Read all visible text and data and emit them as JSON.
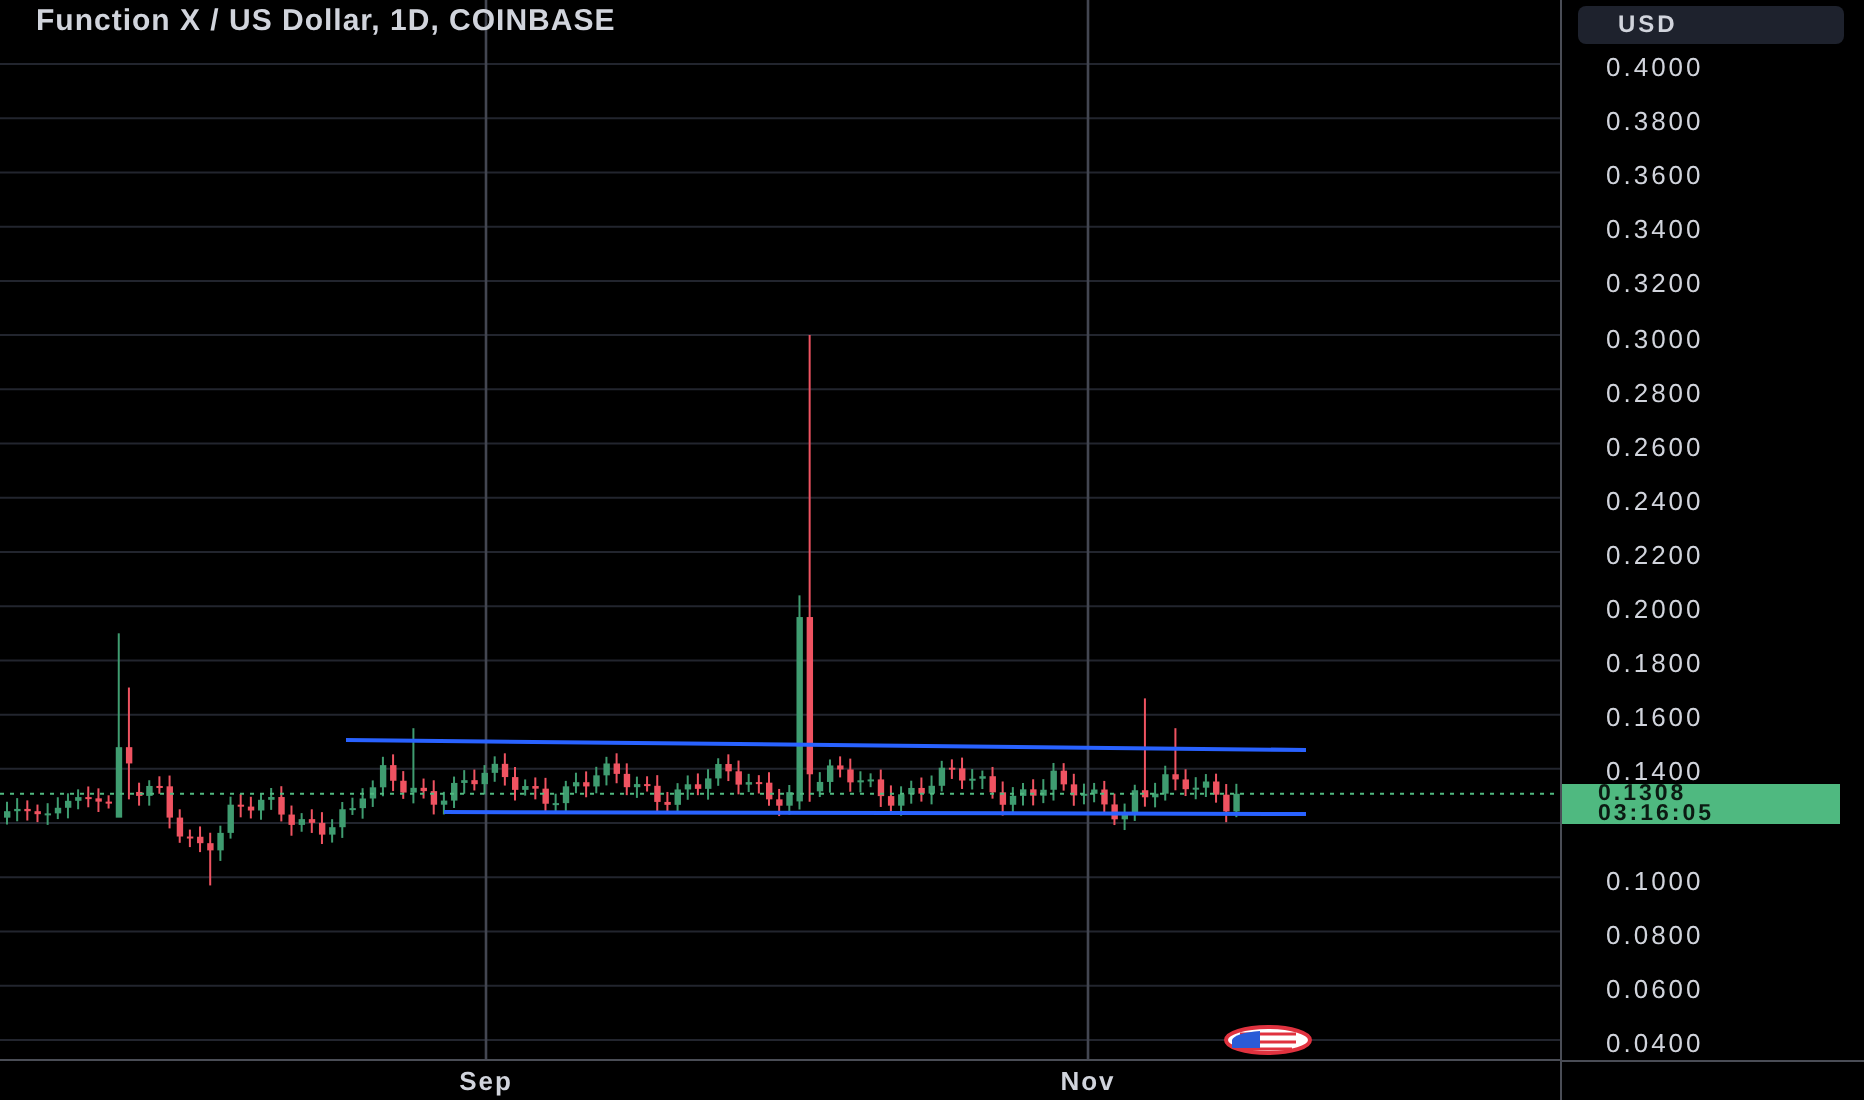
{
  "legend": {
    "title": "Function X / US Dollar, 1D, COINBASE"
  },
  "price_scale": {
    "currency": "USD",
    "ticks": [
      "0.4000",
      "0.3800",
      "0.3600",
      "0.3400",
      "0.3200",
      "0.3000",
      "0.2800",
      "0.2600",
      "0.2400",
      "0.2200",
      "0.2000",
      "0.1800",
      "0.1600",
      "0.1400",
      "0.1000",
      "0.0800",
      "0.0600",
      "0.0400"
    ],
    "last_price": {
      "price": "0.1308",
      "countdown": "03:16:05",
      "color": "#4fb980"
    }
  },
  "time_scale": {
    "labels": [
      "Sep",
      "Nov"
    ]
  }
}
